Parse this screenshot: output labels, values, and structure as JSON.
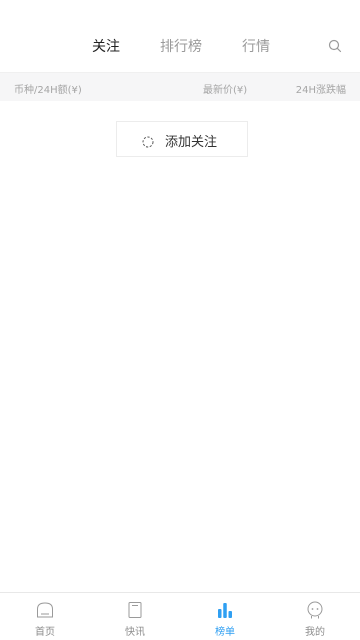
{
  "header": {
    "tabs": [
      {
        "label": "关注",
        "active": true
      },
      {
        "label": "排行榜",
        "active": false
      },
      {
        "label": "行情",
        "active": false
      }
    ],
    "search_icon": "search-icon"
  },
  "columns": {
    "left": "币种/24H额(¥)",
    "middle": "最新价(¥)",
    "right": "24H涨跌幅"
  },
  "add_follow": {
    "label": "添加关注",
    "icon": "circle-plus-icon"
  },
  "bottom_nav": {
    "items": [
      {
        "label": "首页",
        "icon": "home-icon",
        "active": false
      },
      {
        "label": "快讯",
        "icon": "news-icon",
        "active": false
      },
      {
        "label": "榜单",
        "icon": "ranking-icon",
        "active": true
      },
      {
        "label": "我的",
        "icon": "profile-icon",
        "active": false
      }
    ]
  },
  "colors": {
    "accent": "#2f9ff2",
    "inactive_text": "#8d8d8d",
    "header_bg": "#f6f6f7"
  }
}
